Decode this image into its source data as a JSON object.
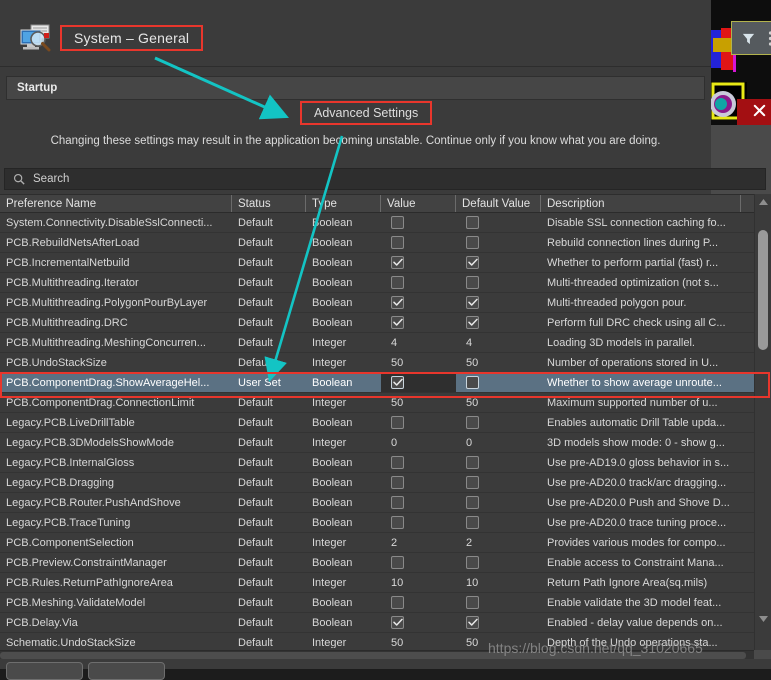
{
  "dialog": {
    "title": "System – General",
    "title_icon": "system-monitor-magnifier-icon",
    "section_label": "Startup",
    "advanced_button": "Advanced Settings",
    "warning": "Changing these settings may result in the application becoming unstable. Continue only if you know what you are doing.",
    "search": {
      "placeholder": "Search",
      "value": "",
      "icon": "search-icon"
    }
  },
  "grid": {
    "columns": [
      "Preference Name",
      "Status",
      "Type",
      "Value",
      "Default Value",
      "Description"
    ],
    "rows": [
      {
        "name": "System.Connectivity.DisableSslConnecti...",
        "status": "Default",
        "type": "Boolean",
        "value": false,
        "default": false,
        "desc": "Disable SSL connection caching fo...",
        "selected": false
      },
      {
        "name": "PCB.RebuildNetsAfterLoad",
        "status": "Default",
        "type": "Boolean",
        "value": false,
        "default": false,
        "desc": "Rebuild connection lines during P...",
        "selected": false
      },
      {
        "name": "PCB.IncrementalNetbuild",
        "status": "Default",
        "type": "Boolean",
        "value": true,
        "default": true,
        "desc": "Whether to perform partial (fast) r...",
        "selected": false
      },
      {
        "name": "PCB.Multithreading.Iterator",
        "status": "Default",
        "type": "Boolean",
        "value": false,
        "default": false,
        "desc": "Multi-threaded optimization (not s...",
        "selected": false
      },
      {
        "name": "PCB.Multithreading.PolygonPourByLayer",
        "status": "Default",
        "type": "Boolean",
        "value": true,
        "default": true,
        "desc": "Multi-threaded polygon pour.",
        "selected": false
      },
      {
        "name": "PCB.Multithreading.DRC",
        "status": "Default",
        "type": "Boolean",
        "value": true,
        "default": true,
        "desc": "Perform full DRC check using all C...",
        "selected": false
      },
      {
        "name": "PCB.Multithreading.MeshingConcurren...",
        "status": "Default",
        "type": "Integer",
        "value": "4",
        "default": "4",
        "desc": "Loading 3D models in parallel.",
        "selected": false
      },
      {
        "name": "PCB.UndoStackSize",
        "status": "Default",
        "type": "Integer",
        "value": "50",
        "default": "50",
        "desc": "Number of operations stored in U...",
        "selected": false
      },
      {
        "name": "PCB.ComponentDrag.ShowAverageHel...",
        "status": "User Set",
        "type": "Boolean",
        "value": true,
        "default": false,
        "desc": "Whether to show average unroute...",
        "selected": true
      },
      {
        "name": "PCB.ComponentDrag.ConnectionLimit",
        "status": "Default",
        "type": "Integer",
        "value": "50",
        "default": "50",
        "desc": "Maximum supported number of u...",
        "selected": false
      },
      {
        "name": "Legacy.PCB.LiveDrillTable",
        "status": "Default",
        "type": "Boolean",
        "value": false,
        "default": false,
        "desc": "Enables automatic Drill Table upda...",
        "selected": false
      },
      {
        "name": "Legacy.PCB.3DModelsShowMode",
        "status": "Default",
        "type": "Integer",
        "value": "0",
        "default": "0",
        "desc": "3D models show mode: 0 - show g...",
        "selected": false
      },
      {
        "name": "Legacy.PCB.InternalGloss",
        "status": "Default",
        "type": "Boolean",
        "value": false,
        "default": false,
        "desc": "Use pre-AD19.0 gloss behavior in s...",
        "selected": false
      },
      {
        "name": "Legacy.PCB.Dragging",
        "status": "Default",
        "type": "Boolean",
        "value": false,
        "default": false,
        "desc": "Use pre-AD20.0 track/arc dragging...",
        "selected": false
      },
      {
        "name": "Legacy.PCB.Router.PushAndShove",
        "status": "Default",
        "type": "Boolean",
        "value": false,
        "default": false,
        "desc": "Use pre-AD20.0 Push and Shove D...",
        "selected": false
      },
      {
        "name": "Legacy.PCB.TraceTuning",
        "status": "Default",
        "type": "Boolean",
        "value": false,
        "default": false,
        "desc": "Use pre-AD20.0 trace tuning proce...",
        "selected": false
      },
      {
        "name": "PCB.ComponentSelection",
        "status": "Default",
        "type": "Integer",
        "value": "2",
        "default": "2",
        "desc": "Provides various modes for compo...",
        "selected": false
      },
      {
        "name": "PCB.Preview.ConstraintManager",
        "status": "Default",
        "type": "Boolean",
        "value": false,
        "default": false,
        "desc": "Enable access to Constraint Mana...",
        "selected": false
      },
      {
        "name": "PCB.Rules.ReturnPathIgnoreArea",
        "status": "Default",
        "type": "Integer",
        "value": "10",
        "default": "10",
        "desc": "Return Path Ignore Area(sq.mils)",
        "selected": false
      },
      {
        "name": "PCB.Meshing.ValidateModel",
        "status": "Default",
        "type": "Boolean",
        "value": false,
        "default": false,
        "desc": "Enable validate the 3D model feat...",
        "selected": false
      },
      {
        "name": "PCB.Delay.Via",
        "status": "Default",
        "type": "Boolean",
        "value": true,
        "default": true,
        "desc": "Enabled - delay value depends on...",
        "selected": false
      },
      {
        "name": "Schematic.UndoStackSize",
        "status": "Default",
        "type": "Integer",
        "value": "50",
        "default": "50",
        "desc": "Depth of the Undo operations sta...",
        "selected": false
      }
    ]
  },
  "right_strip": {
    "filter_icon": "filter-funnel-icon",
    "overflow_icon": "more-vertical-icon",
    "close_icon": "close-x-icon"
  },
  "annotations": {
    "arrow_color": "#13c4c4",
    "highlight_color": "#e8362c"
  },
  "watermark": "https://blog.csdn.net/qq_31020665"
}
